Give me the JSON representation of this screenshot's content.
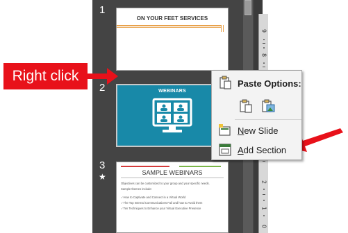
{
  "thumbnails": [
    {
      "number": "1",
      "title": "ON YOUR FEET SERVICES"
    },
    {
      "number": "2",
      "title": "WEBINARS"
    },
    {
      "number": "3",
      "star": "★",
      "title": "SAMPLE WEBINARS",
      "lines": [
        "Objectives can be customized to your group and your specific needs.",
        "Sample themes include:",
        "✓How to Captivate and Connect in a Virtual World",
        "✓The Top Internal Communications Fail and how to Avoid them",
        "✓Ten Techniques to Enhance your Virtual Executive Presence"
      ]
    }
  ],
  "ruler": {
    "labels": [
      "9",
      "8",
      "7",
      "2",
      "1",
      "0"
    ]
  },
  "callout": {
    "text": "Right click"
  },
  "context_menu": {
    "paste_options_label": "Paste Options:",
    "paste_option_icons": [
      "paste-keep-formatting-icon",
      "paste-picture-icon"
    ],
    "items": [
      {
        "mnemonic": "N",
        "rest": "ew Slide",
        "icon": "new-slide-icon"
      },
      {
        "mnemonic": "A",
        "rest": "dd Section",
        "icon": "add-section-icon"
      }
    ]
  },
  "colors": {
    "callout": "#e8111a",
    "pane": "#444444",
    "webinar_slide": "#1889a8",
    "accent_orange": "#e8a24c"
  }
}
